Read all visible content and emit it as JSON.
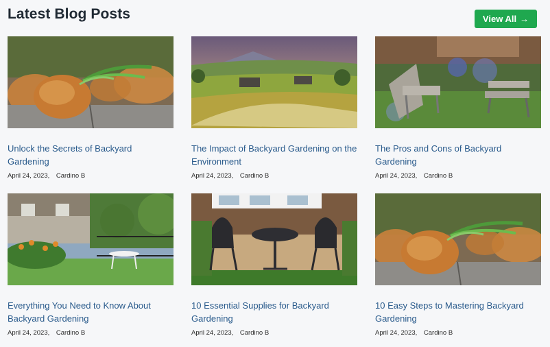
{
  "header": {
    "title": "Latest Blog Posts",
    "view_all_label": "View All",
    "view_all_arrow": "→"
  },
  "colors": {
    "accent": "#1fa84f",
    "link": "#2a5b8c",
    "background": "#f6f7f9"
  },
  "posts": [
    {
      "title": "Unlock the Secrets of Backyard Gardening",
      "date": "April 24, 2023",
      "author": "Cardino B",
      "image": "onion-bulb"
    },
    {
      "title": "The Impact of Backyard Gardening on the Environment",
      "date": "April 24, 2023",
      "author": "Cardino B",
      "image": "countryside-landscape"
    },
    {
      "title": "The Pros and Cons of Backyard Gardening",
      "date": "April 24, 2023",
      "author": "Cardino B",
      "image": "garden-chairs"
    },
    {
      "title": "Everything You Need to Know About Backyard Gardening",
      "date": "April 24, 2023",
      "author": "Cardino B",
      "image": "house-yard-flowers"
    },
    {
      "title": "10 Essential Supplies for Backyard Gardening",
      "date": "April 24, 2023",
      "author": "Cardino B",
      "image": "patio-bistro-set"
    },
    {
      "title": "10 Easy Steps to Mastering Backyard Gardening",
      "date": "April 24, 2023",
      "author": "Cardino B",
      "image": "onion-bulb"
    }
  ]
}
